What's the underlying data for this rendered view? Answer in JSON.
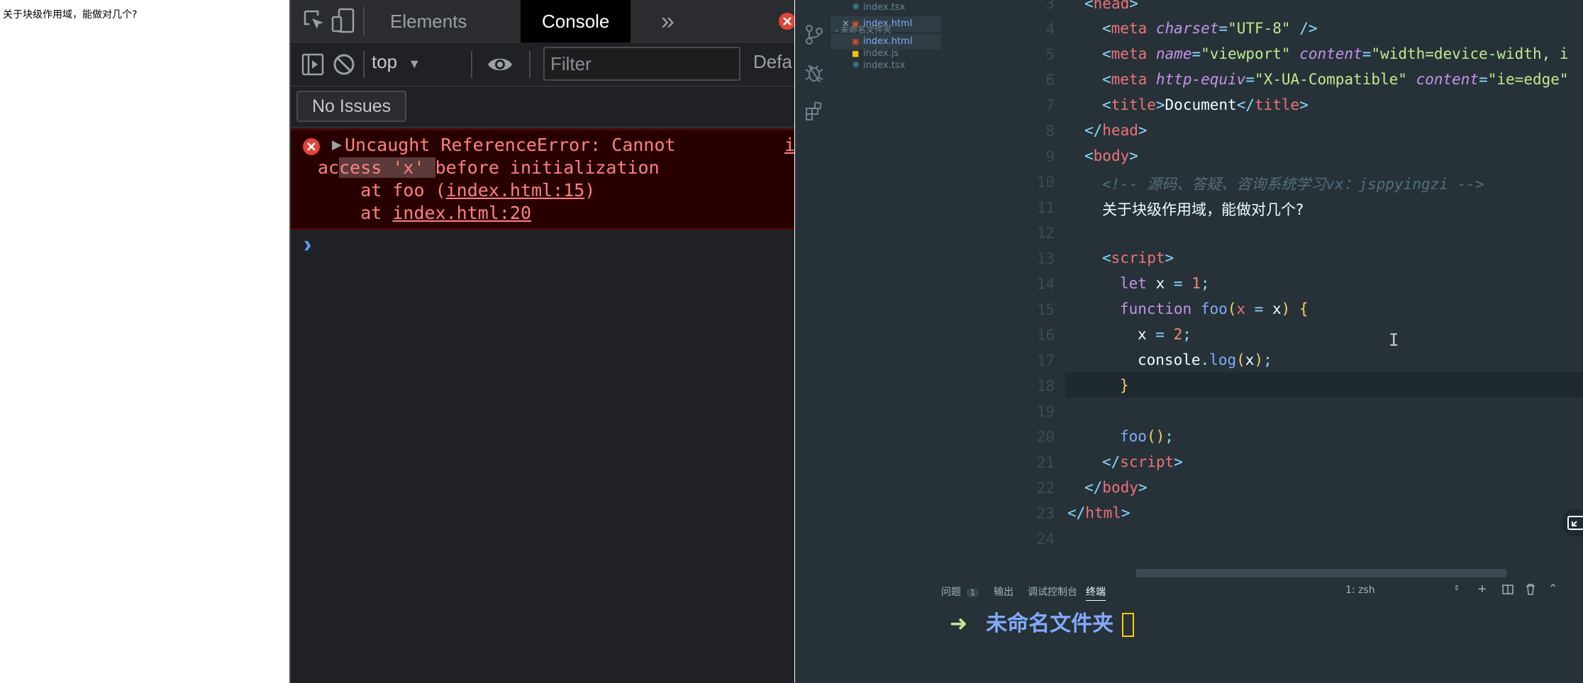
{
  "page": {
    "text": "关于块级作用域，能做对几个?"
  },
  "devtools": {
    "tabs": [
      "Elements",
      "Console"
    ],
    "active_tab": "Console",
    "more_tabs_glyph": "»",
    "toolbar": {
      "context": "top",
      "filter_placeholder": "Filter",
      "levels": "Defa"
    },
    "issues_label": "No Issues",
    "error": {
      "line1": "Uncaught ReferenceError: Cannot",
      "line2_pre": "ac",
      "line2_mark": "cess 'x' ",
      "line2_post": "before initialization",
      "stack1_prefix": "    at foo (",
      "stack1_link": "index.html:15",
      "stack1_suffix": ")",
      "stack2_prefix": "    at ",
      "stack2_link": "index.html:20",
      "source_link": "i"
    },
    "prompt_glyph": "›"
  },
  "vscode": {
    "explorer": {
      "items": [
        {
          "label": "index.tsx",
          "icon": "react-icon"
        },
        {
          "label": "index.html",
          "icon": "html-icon",
          "modified": true
        },
        {
          "label": "未命名文件夹",
          "icon": "folder-chevron"
        },
        {
          "label": "index.html",
          "icon": "html-icon"
        },
        {
          "label": "index.js",
          "icon": "js-icon"
        },
        {
          "label": "index.tsx",
          "icon": "react-icon"
        }
      ]
    },
    "editor": {
      "line_numbers": [
        "3",
        "4",
        "5",
        "6",
        "7",
        "8",
        "9",
        "10",
        "11",
        "12",
        "13",
        "14",
        "15",
        "16",
        "17",
        "18",
        "19",
        "20",
        "21",
        "22",
        "23",
        "24"
      ],
      "title_text": "Document",
      "comment_text": "源码、答疑、咨询系统学习vx：jsppyingzi",
      "body_text": "关于块级作用域，能做对几个?",
      "charset": "\"UTF-8\"",
      "viewport_name": "\"viewport\"",
      "viewport_content": "\"width=device-width, i",
      "compat_equiv": "\"X-UA-Compatible\"",
      "compat_content": "\"ie=edge\""
    },
    "panel": {
      "tabs": [
        "问题",
        "输出",
        "调试控制台",
        "终端"
      ],
      "problem_count": "1",
      "active_tab": "终端",
      "terminal_select": "1: zsh",
      "terminal_dir": "未命名文件夹"
    }
  },
  "colors": {
    "devtools_bg": "#202124",
    "error_bg": "#290000",
    "error_text": "#ff8080",
    "editor_bg": "#263238"
  }
}
